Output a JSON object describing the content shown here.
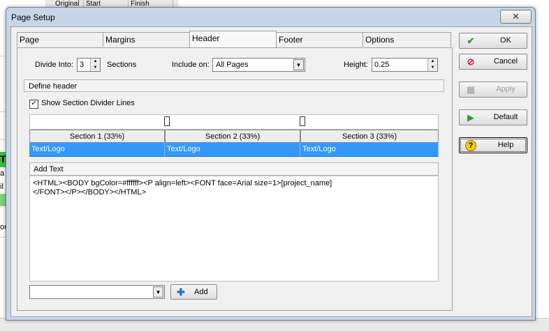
{
  "background": {
    "columns": [
      "Original",
      "Start",
      "Finish"
    ],
    "left_fragments": [
      "T",
      "a",
      "il",
      "or"
    ]
  },
  "dialog": {
    "title": "Page Setup",
    "close_glyph": "✕"
  },
  "tabs": [
    {
      "label": "Page",
      "active": false
    },
    {
      "label": "Margins",
      "active": false
    },
    {
      "label": "Header",
      "active": true
    },
    {
      "label": "Footer",
      "active": false
    },
    {
      "label": "Options",
      "active": false
    }
  ],
  "header_tab": {
    "divide_into_label": "Divide Into:",
    "divide_into_value": "3",
    "sections_label": "Sections",
    "include_on_label": "Include on:",
    "include_on_value": "All Pages",
    "height_label": "Height:",
    "height_value": "0.25",
    "define_header_label": "Define header",
    "show_divider_label": "Show Section Divider Lines",
    "show_divider_checked": true,
    "sections": [
      {
        "header": "Section 1 (33%)",
        "content": "Text/Logo"
      },
      {
        "header": "Section 2 (33%)",
        "content": "Text/Logo"
      },
      {
        "header": "Section 3 (33%)",
        "content": "Text/Logo"
      }
    ],
    "add_text_label": "Add Text",
    "editor_text": "<HTML><BODY bgColor=#ffffff><P align=left><FONT face=Arial size=1>[project_name]\n</FONT></P></BODY></HTML>",
    "field_combo_value": "",
    "add_button_label": "Add"
  },
  "side_buttons": {
    "ok": "OK",
    "cancel": "Cancel",
    "apply": "Apply",
    "default": "Default",
    "help": "Help"
  },
  "colors": {
    "selection": "#3399ff",
    "ok_icon": "#2e9a2e",
    "cancel_icon": "#d42020",
    "help_icon": "#e8c000"
  }
}
